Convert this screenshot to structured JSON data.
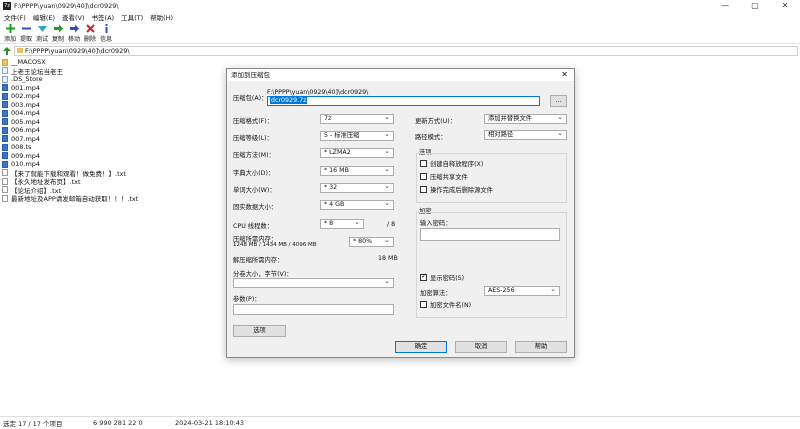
{
  "window": {
    "app_icon": "7z",
    "title": "F:\\PPPP\\yuan\\0929\\40]\\dcr0929\\",
    "minimize": "—",
    "restore": "▢",
    "close": "✕"
  },
  "menu": [
    "文件(F)",
    "编辑(E)",
    "查看(V)",
    "书签(A)",
    "工具(T)",
    "帮助(H)"
  ],
  "toolbar": [
    {
      "icon": "add-icon",
      "label": "添加",
      "color": "#1aa31a"
    },
    {
      "icon": "extract-icon",
      "label": "提取",
      "color": "#2b4fc9"
    },
    {
      "icon": "test-icon",
      "label": "测试",
      "color": "#2aa7b8"
    },
    {
      "icon": "copy-icon",
      "label": "复制",
      "color": "#1aa31a"
    },
    {
      "icon": "move-icon",
      "label": "移动",
      "color": "#2b4fc9"
    },
    {
      "icon": "delete-icon",
      "label": "删除",
      "color": "#d42020"
    },
    {
      "icon": "info-icon",
      "label": "信息",
      "color": "#2b4fc9"
    }
  ],
  "address": "F:\\PPPP\\yuan\\0929\\40]\\dcr0929\\",
  "files": [
    {
      "name": "__MACOSX",
      "type": "folder"
    },
    {
      "name": "上老王论坛当老王",
      "type": "file"
    },
    {
      "name": ".DS_Store",
      "type": "file"
    },
    {
      "name": "001.mp4",
      "type": "media"
    },
    {
      "name": "002.mp4",
      "type": "media"
    },
    {
      "name": "003.mp4",
      "type": "media"
    },
    {
      "name": "004.mp4",
      "type": "media"
    },
    {
      "name": "005.mp4",
      "type": "media"
    },
    {
      "name": "006.mp4",
      "type": "media"
    },
    {
      "name": "007.mp4",
      "type": "media"
    },
    {
      "name": "008.ts",
      "type": "media"
    },
    {
      "name": "009.mp4",
      "type": "media"
    },
    {
      "name": "010.mp4",
      "type": "media"
    },
    {
      "name": "【来了就能下载和观看！做免费！】.txt",
      "type": "txt"
    },
    {
      "name": "【永久地址发布页】.txt",
      "type": "txt"
    },
    {
      "name": "【论坛介绍】.txt",
      "type": "txt"
    },
    {
      "name": "最新地址及APP请发邮箱自动获取！！！.txt",
      "type": "txt"
    }
  ],
  "status": {
    "selected": "选定 17 / 17 个项目",
    "size": "6 990 281 22 0",
    "modified": "2024-03-21 18:10:43"
  },
  "dialog": {
    "title": "添加到压缩包",
    "close": "✕",
    "archive_label": "压缩包(A)：",
    "archive_path": "F:\\PPPP\\yuan\\0929\\40]\\dcr0929\\",
    "archive_name": "dcr0929.7z",
    "browse": "...",
    "format_label": "压缩格式(F)：",
    "format": "7z",
    "level_label": "压缩等级(L)：",
    "level": "5 - 标准压缩",
    "method_label": "压缩方法(M)：",
    "method": "* LZMA2",
    "dict_label": "字典大小(D)：",
    "dict": "* 16 MB",
    "word_label": "单词大小(W)：",
    "word": "* 32",
    "solid_label": "固实数据大小：",
    "solid": "* 4 GB",
    "threads_label": "CPU 线程数：",
    "threads": "* 8",
    "threads_max": "/ 8",
    "mem_label": "压缩所需内存：",
    "mem_value": "1248 MB / 1434 MB / 4096 MB",
    "mem_percent": "* 80%",
    "demem_label": "解压缩所需内存：",
    "demem_value": "18 MB",
    "split_label": "分卷大小，字节(V)：",
    "params_label": "参数(P)：",
    "options_btn": "选项",
    "update_label": "更新方式(U)：",
    "update": "添加并替换文件",
    "pathmode_label": "路径模式：",
    "pathmode": "相对路径",
    "options_group": "选项",
    "opt_sfx": "创建自释放程序(X)",
    "opt_shared": "压缩共享文件",
    "opt_delete": "操作完成后删除源文件",
    "enc_group": "加密",
    "pwd_label": "输入密码：",
    "show_pwd": "显示密码(S)",
    "enc_method_label": "加密算法：",
    "enc_method": "AES-256",
    "enc_names": "加密文件名(N)",
    "ok": "确定",
    "cancel": "取消",
    "help": "帮助"
  }
}
